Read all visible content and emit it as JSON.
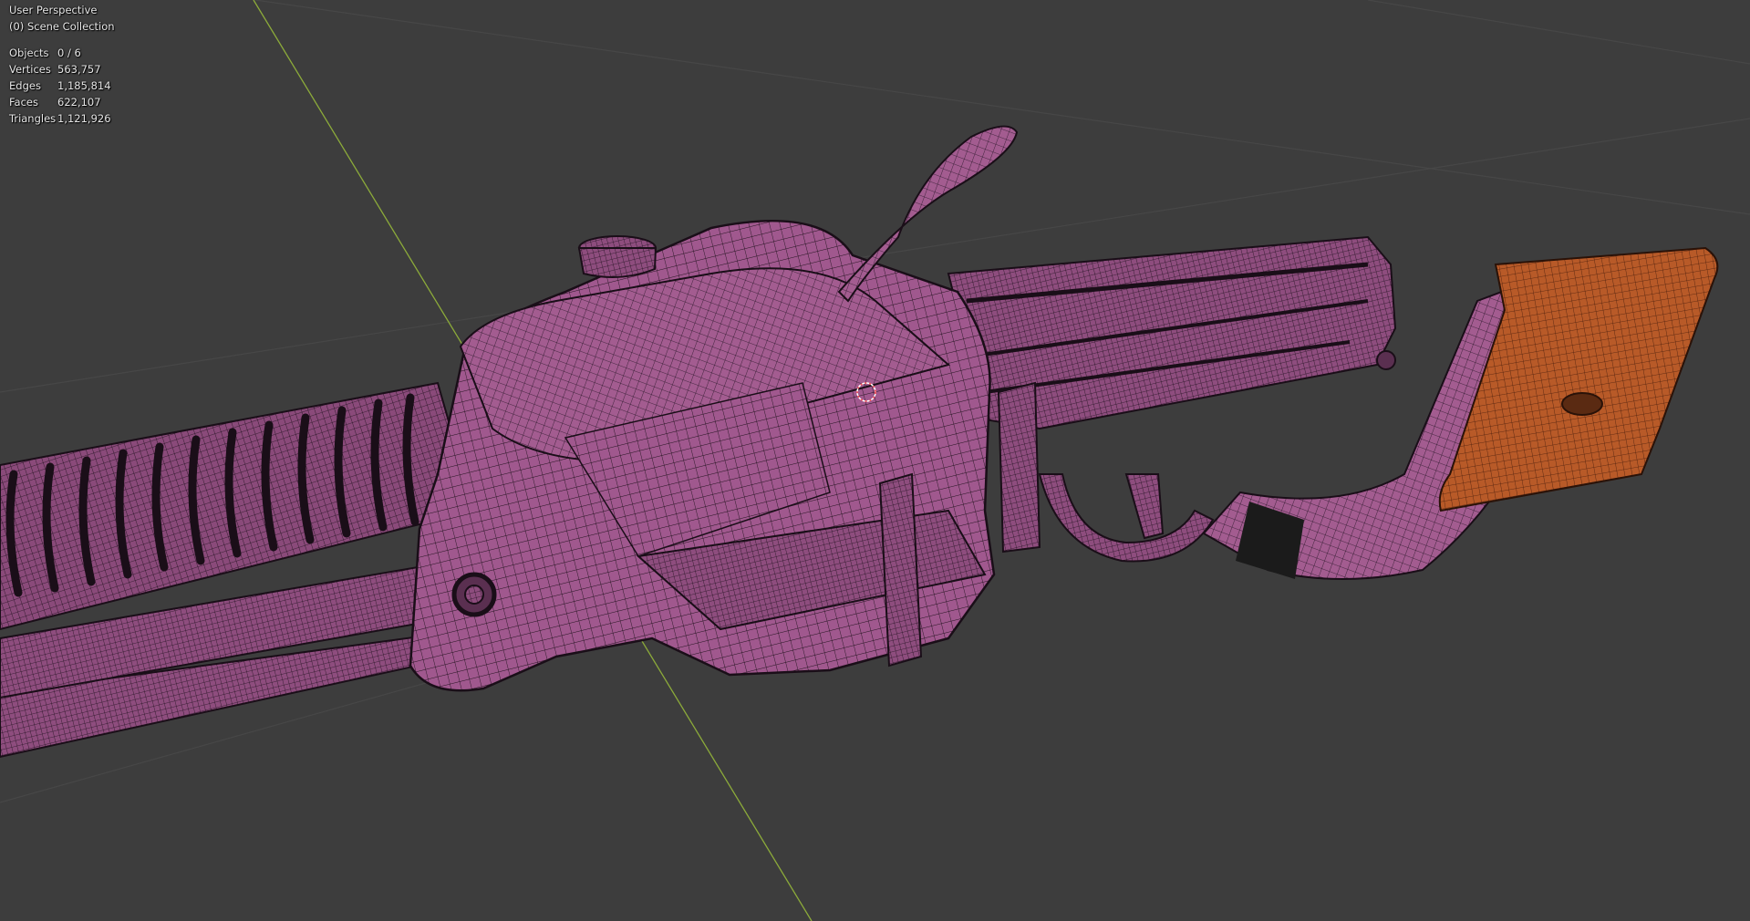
{
  "viewport": {
    "view_name": "User Perspective",
    "collection": "(0) Scene Collection",
    "background_color": "#3d3d3d",
    "grid_color": "#484848",
    "y_axis_color": "#8cab3a",
    "mesh_color": "#9e5a8c",
    "wire_color": "#1c1018",
    "wood_color": "#b85a28",
    "cursor_color": "#ff5050"
  },
  "stats": [
    {
      "label": "Objects",
      "value": "0 / 6"
    },
    {
      "label": "Vertices",
      "value": "563,757"
    },
    {
      "label": "Edges",
      "value": "1,185,814"
    },
    {
      "label": "Faces",
      "value": "622,107"
    },
    {
      "label": "Triangles",
      "value": "1,121,926"
    }
  ]
}
